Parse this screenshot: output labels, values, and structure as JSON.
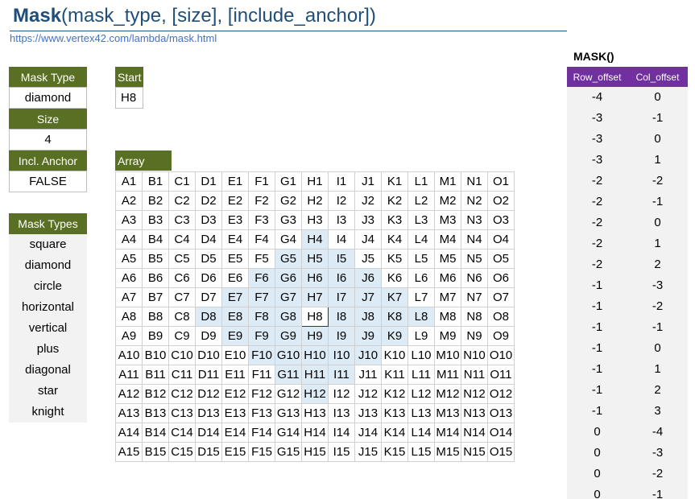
{
  "header": {
    "func_name": "Mask",
    "func_args": "(mask_type, [size], [include_anchor])",
    "url": "https://www.vertex42.com/lambda/mask.html"
  },
  "inputs": {
    "mask_type_label": "Mask Type",
    "mask_type_value": "diamond",
    "size_label": "Size",
    "size_value": "4",
    "anchor_label": "Incl. Anchor",
    "anchor_value": "FALSE",
    "start_label": "Start",
    "start_value": "H8",
    "array_label": "Array"
  },
  "mask_types": {
    "label": "Mask Types",
    "items": [
      "square",
      "diamond",
      "circle",
      "horizontal",
      "vertical",
      "plus",
      "diagonal",
      "star",
      "knight"
    ]
  },
  "grid": {
    "columns": [
      "A",
      "B",
      "C",
      "D",
      "E",
      "F",
      "G",
      "H",
      "I",
      "J",
      "K",
      "L",
      "M",
      "N",
      "O"
    ],
    "rows": 15,
    "anchor": "H8",
    "highlighted": [
      "H4",
      "G5",
      "H5",
      "I5",
      "F6",
      "G6",
      "H6",
      "I6",
      "J6",
      "E7",
      "F7",
      "G7",
      "H7",
      "I7",
      "J7",
      "K7",
      "D8",
      "E8",
      "F8",
      "G8",
      "I8",
      "J8",
      "K8",
      "L8",
      "E9",
      "F9",
      "G9",
      "H9",
      "I9",
      "J9",
      "K9",
      "F10",
      "G10",
      "H10",
      "I10",
      "J10",
      "G11",
      "H11",
      "I11",
      "H12"
    ]
  },
  "mask_output": {
    "title": "MASK()",
    "col1": "Row_offset",
    "col2": "Col_offset",
    "rows": [
      [
        "-4",
        "0"
      ],
      [
        "-3",
        "-1"
      ],
      [
        "-3",
        "0"
      ],
      [
        "-3",
        "1"
      ],
      [
        "-2",
        "-2"
      ],
      [
        "-2",
        "-1"
      ],
      [
        "-2",
        "0"
      ],
      [
        "-2",
        "1"
      ],
      [
        "-2",
        "2"
      ],
      [
        "-1",
        "-3"
      ],
      [
        "-1",
        "-2"
      ],
      [
        "-1",
        "-1"
      ],
      [
        "-1",
        "0"
      ],
      [
        "-1",
        "1"
      ],
      [
        "-1",
        "2"
      ],
      [
        "-1",
        "3"
      ],
      [
        "0",
        "-4"
      ],
      [
        "0",
        "-3"
      ],
      [
        "0",
        "-2"
      ],
      [
        "0",
        "-1"
      ]
    ]
  },
  "colors": {
    "input_header": "#596F23",
    "output_header": "#7030A0",
    "highlight": "#DDEBF7",
    "title": "#1F4E79",
    "link": "#4472C4"
  }
}
